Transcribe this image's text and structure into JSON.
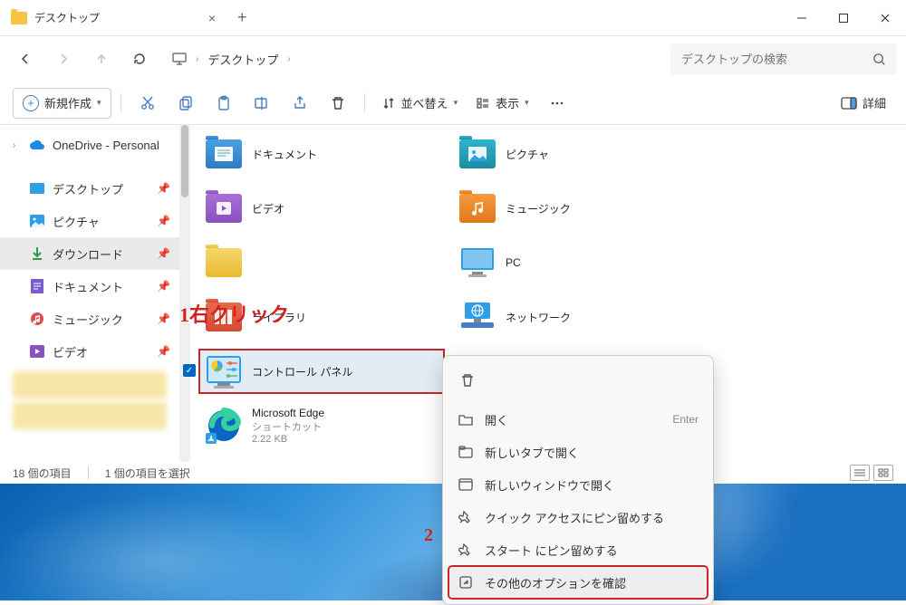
{
  "tab": {
    "title": "デスクトップ"
  },
  "address": {
    "root_icon": "monitor",
    "crumb": "デスクトップ"
  },
  "search": {
    "placeholder": "デスクトップの検索"
  },
  "toolbar": {
    "new": "新規作成",
    "sort": "並べ替え",
    "view": "表示",
    "details": "詳細"
  },
  "sidebar": {
    "onedrive": "OneDrive - Personal",
    "items": [
      {
        "label": "デスクトップ"
      },
      {
        "label": "ピクチャ"
      },
      {
        "label": "ダウンロード"
      },
      {
        "label": "ドキュメント"
      },
      {
        "label": "ミュージック"
      },
      {
        "label": "ビデオ"
      }
    ]
  },
  "grid": {
    "documents": "ドキュメント",
    "pictures": "ピクチャ",
    "videos": "ビデオ",
    "music": "ミュージック",
    "pc": "PC",
    "library": "ライブラリ",
    "network": "ネットワーク",
    "control_panel": "コントロール パネル",
    "edge": {
      "name": "Microsoft Edge",
      "type": "ショートカット",
      "size": "2.22 KB"
    }
  },
  "annotations": {
    "a1_num": "1",
    "a1_text": "右クリック",
    "a2_num": "2"
  },
  "context_menu": {
    "open": "開く",
    "open_accel": "Enter",
    "new_tab": "新しいタブで開く",
    "new_window": "新しいウィンドウで開く",
    "pin_quick": "クイック アクセスにピン留めする",
    "pin_start": "スタート にピン留めする",
    "more_options": "その他のオプションを確認"
  },
  "status": {
    "count": "18 個の項目",
    "selected": "1 個の項目を選択"
  }
}
